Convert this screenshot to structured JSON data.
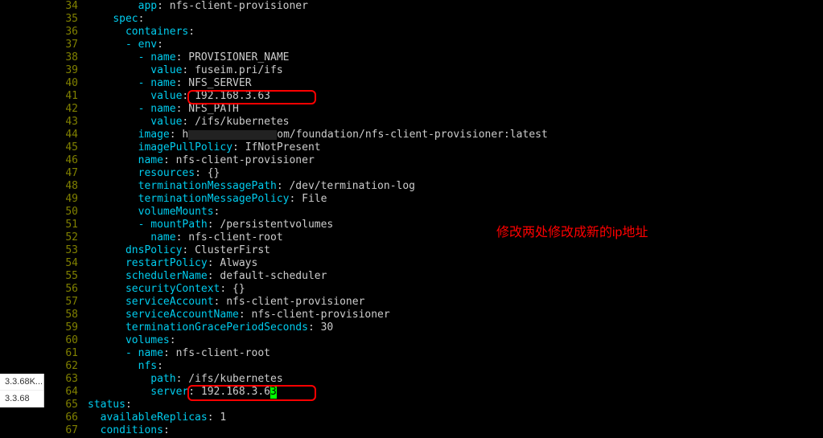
{
  "sidebar": {
    "items": [
      {
        "label": "3.3.68K..."
      },
      {
        "label": "3.3.68"
      }
    ]
  },
  "editor": {
    "lines": [
      {
        "num": "34",
        "indent": "        ",
        "key": "app",
        "value": "nfs-client-provisioner"
      },
      {
        "num": "35",
        "indent": "    ",
        "key": "spec",
        "value": ""
      },
      {
        "num": "36",
        "indent": "      ",
        "key": "containers",
        "value": ""
      },
      {
        "num": "37",
        "indent": "      ",
        "key": "- env",
        "value": ""
      },
      {
        "num": "38",
        "indent": "        ",
        "key": "- name",
        "value": "PROVISIONER_NAME"
      },
      {
        "num": "39",
        "indent": "          ",
        "key": "value",
        "value": "fuseim.pri/ifs"
      },
      {
        "num": "40",
        "indent": "        ",
        "key": "- name",
        "value": "NFS_SERVER"
      },
      {
        "num": "41",
        "indent": "          ",
        "key": "value",
        "value": "192.168.3.63"
      },
      {
        "num": "42",
        "indent": "        ",
        "key": "- name",
        "value": "NFS_PATH"
      },
      {
        "num": "43",
        "indent": "          ",
        "key": "value",
        "value": "/ifs/kubernetes"
      },
      {
        "num": "44",
        "indent": "        ",
        "key": "image",
        "value": "h",
        "suffix": "om/foundation/nfs-client-provisioner:latest",
        "redacted": true
      },
      {
        "num": "45",
        "indent": "        ",
        "key": "imagePullPolicy",
        "value": "IfNotPresent"
      },
      {
        "num": "46",
        "indent": "        ",
        "key": "name",
        "value": "nfs-client-provisioner"
      },
      {
        "num": "47",
        "indent": "        ",
        "key": "resources",
        "value": "{}"
      },
      {
        "num": "48",
        "indent": "        ",
        "key": "terminationMessagePath",
        "value": "/dev/termination-log"
      },
      {
        "num": "49",
        "indent": "        ",
        "key": "terminationMessagePolicy",
        "value": "File"
      },
      {
        "num": "50",
        "indent": "        ",
        "key": "volumeMounts",
        "value": ""
      },
      {
        "num": "51",
        "indent": "        ",
        "key": "- mountPath",
        "value": "/persistentvolumes"
      },
      {
        "num": "52",
        "indent": "          ",
        "key": "name",
        "value": "nfs-client-root"
      },
      {
        "num": "53",
        "indent": "      ",
        "key": "dnsPolicy",
        "value": "ClusterFirst"
      },
      {
        "num": "54",
        "indent": "      ",
        "key": "restartPolicy",
        "value": "Always"
      },
      {
        "num": "55",
        "indent": "      ",
        "key": "schedulerName",
        "value": "default-scheduler"
      },
      {
        "num": "56",
        "indent": "      ",
        "key": "securityContext",
        "value": "{}"
      },
      {
        "num": "57",
        "indent": "      ",
        "key": "serviceAccount",
        "value": "nfs-client-provisioner"
      },
      {
        "num": "58",
        "indent": "      ",
        "key": "serviceAccountName",
        "value": "nfs-client-provisioner"
      },
      {
        "num": "59",
        "indent": "      ",
        "key": "terminationGracePeriodSeconds",
        "value": "30"
      },
      {
        "num": "60",
        "indent": "      ",
        "key": "volumes",
        "value": ""
      },
      {
        "num": "61",
        "indent": "      ",
        "key": "- name",
        "value": "nfs-client-root"
      },
      {
        "num": "62",
        "indent": "        ",
        "key": "nfs",
        "value": ""
      },
      {
        "num": "63",
        "indent": "          ",
        "key": "path",
        "value": "/ifs/kubernetes"
      },
      {
        "num": "64",
        "indent": "          ",
        "key": "server",
        "value": "192.168.3.6",
        "cursor": "3"
      },
      {
        "num": "65",
        "indent": "",
        "key": "status",
        "value": ""
      },
      {
        "num": "66",
        "indent": "  ",
        "key": "availableReplicas",
        "value": "1"
      },
      {
        "num": "67",
        "indent": "  ",
        "key": "conditions",
        "value": ""
      }
    ]
  },
  "annotation": {
    "text": "修改两处修改成新的ip地址"
  }
}
